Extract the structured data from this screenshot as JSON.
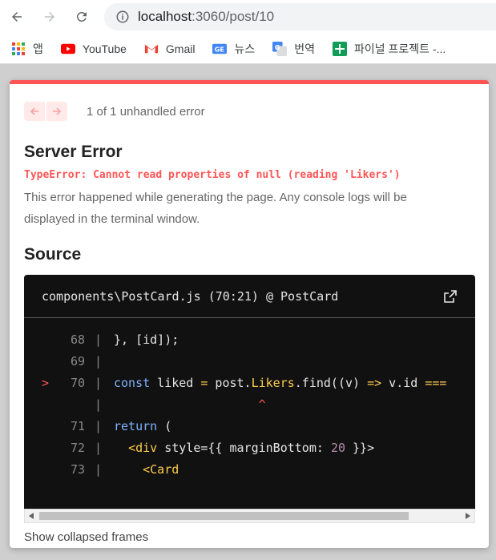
{
  "browser": {
    "url_host": "localhost",
    "url_rest": ":3060/post/10",
    "icons": {
      "back": "arrow-left-icon",
      "forward": "arrow-right-icon",
      "reload": "reload-icon",
      "site_info": "info-icon"
    }
  },
  "bookmarks": [
    {
      "label": "앱",
      "icon": "apps-grid-icon"
    },
    {
      "label": "YouTube",
      "icon": "youtube-icon"
    },
    {
      "label": "Gmail",
      "icon": "gmail-icon"
    },
    {
      "label": "뉴스",
      "icon": "news-icon"
    },
    {
      "label": "번역",
      "icon": "translate-icon"
    },
    {
      "label": "파이널 프로젝트 -...",
      "icon": "sheets-icon"
    }
  ],
  "overlay": {
    "pager_text": "1 of 1 unhandled error",
    "title": "Server Error",
    "message": "TypeError: Cannot read properties of null (reading 'Likers')",
    "description": "This error happened while generating the page. Any console logs will be displayed in the terminal window.",
    "source_title": "Source",
    "file": "components\\PostCard.js (70:21) @ PostCard",
    "collapsed_label": "Show collapsed frames",
    "colors": {
      "accent": "#ff5555",
      "code_bg": "#111111"
    },
    "code_lines": [
      {
        "num": "68",
        "marked": false,
        "text": "}, [id]);"
      },
      {
        "num": "69",
        "marked": false,
        "text": ""
      },
      {
        "num": "70",
        "marked": true,
        "text": "const liked = post.Likers.find((v) => v.id ==="
      },
      {
        "num": "",
        "marked": false,
        "text": "^"
      },
      {
        "num": "71",
        "marked": false,
        "text": "return ("
      },
      {
        "num": "72",
        "marked": false,
        "text": "<div style={{ marginBottom: 20 }}>"
      },
      {
        "num": "73",
        "marked": false,
        "text": "<Card"
      }
    ]
  }
}
